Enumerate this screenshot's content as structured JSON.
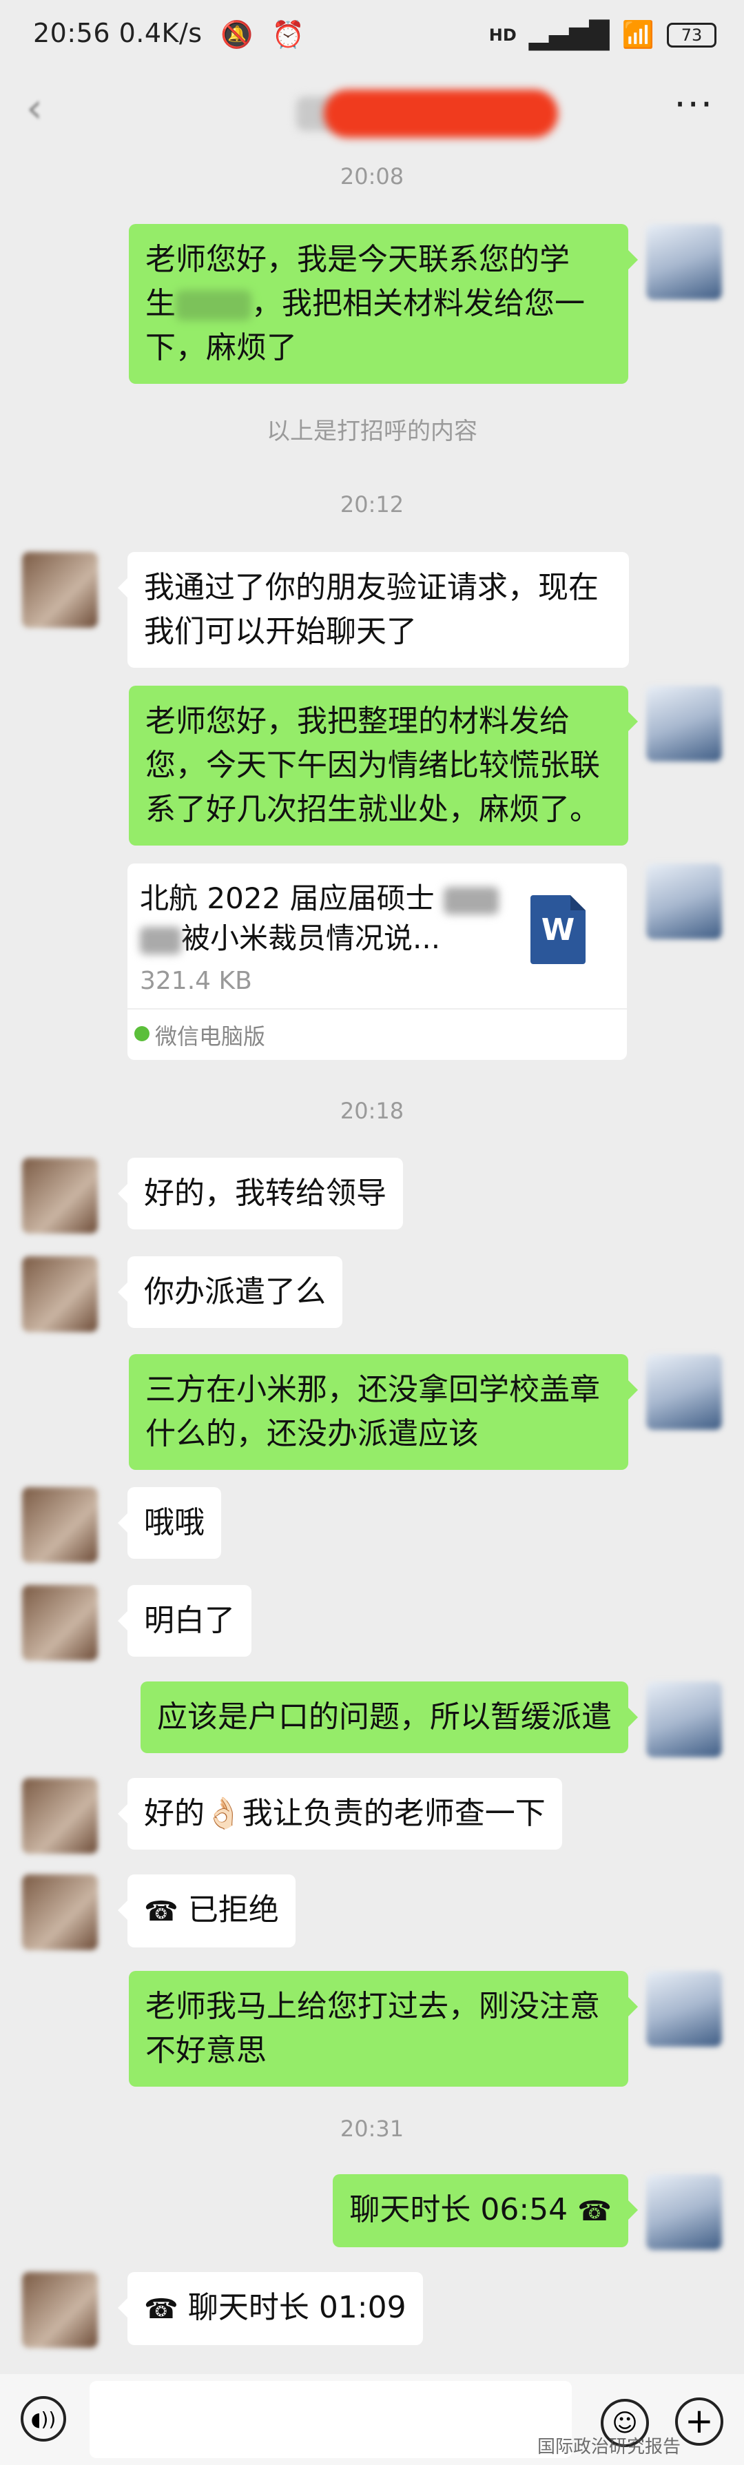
{
  "status_bar": {
    "time": "20:56",
    "speed": "0.4K/s",
    "network": "HD",
    "battery": "73"
  },
  "header": {
    "more": "···"
  },
  "messages": {
    "ts1": "20:08",
    "m1_line1": "老师您好，我是今天联系您的学",
    "m1_line2a": "生",
    "m1_line2b": "，我把相关材料发给您一",
    "m1_line3": "下，麻烦了",
    "sys1": "以上是打招呼的内容",
    "ts2": "20:12",
    "m2_line1": "我通过了你的朋友验证请求，现在",
    "m2_line2": "我们可以开始聊天了",
    "m3_line1": "老师您好，我把整理的材料发给",
    "m3_line2": "您，今天下午因为情绪比较慌张联",
    "m3_line3": "系了好几次招生就业处，麻烦了。",
    "file_title_line1": "北航 2022 届应届硕士",
    "file_title_line2": "被小米裁员情况说...",
    "file_size": "321.4 KB",
    "file_source": "微信电脑版",
    "file_icon": "W",
    "ts3": "20:18",
    "m4": "好的，我转给领导",
    "m5": "你办派遣了么",
    "m6_line1": "三方在小米那，还没拿回学校盖章",
    "m6_line2": "什么的，还没办派遣应该",
    "m7": "哦哦",
    "m8": "明白了",
    "m9": "应该是户口的问题，所以暂缓派遣",
    "m10a": "好的",
    "m10_emoji": "👌🏻",
    "m10b": "我让负责的老师查一下",
    "m11_icon": "☎",
    "m11": "已拒绝",
    "m12_line1": "老师我马上给您打过去，刚没注意",
    "m12_line2": "不好意思",
    "ts4": "20:31",
    "m13": "聊天时长 06:54",
    "m13_icon": "☎",
    "m14_icon": "☎",
    "m14": "聊天时长 01:09"
  },
  "watermark": "国际政治研究报告"
}
